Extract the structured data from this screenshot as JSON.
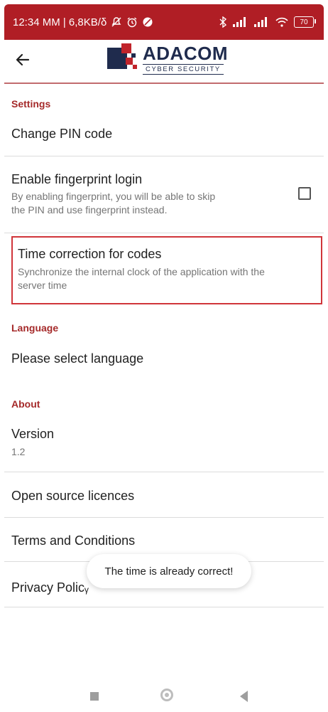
{
  "statusbar": {
    "time": "12:34 MM | 6,8KB/δ",
    "battery": "70",
    "color": "#b01e25"
  },
  "appbar": {
    "logo_title": "ADACOM",
    "logo_subtitle": "CYBER SECURITY"
  },
  "settings": {
    "header": "Settings",
    "change_pin": "Change PIN code",
    "fingerprint_title": "Enable fingerprint login",
    "fingerprint_sub1": "By enabling fingerprint, you will be able to skip",
    "fingerprint_sub2": "the PIN and use fingerprint instead.",
    "fingerprint_checked": false,
    "time_title": "Time correction for codes",
    "time_sub1": "Synchronize the internal clock of the application with the",
    "time_sub2": "server time"
  },
  "language": {
    "header": "Language",
    "select": "Please select language"
  },
  "about": {
    "header": "About",
    "version_label": "Version",
    "version_value": "1.2",
    "licences": "Open source licences",
    "terms": "Terms and Conditions",
    "privacy": "Privacy Policᵧ"
  },
  "toast": {
    "message": "The time is already correct!"
  },
  "colors": {
    "accent": "#a52a2a",
    "highlight_border": "#d0353a"
  }
}
